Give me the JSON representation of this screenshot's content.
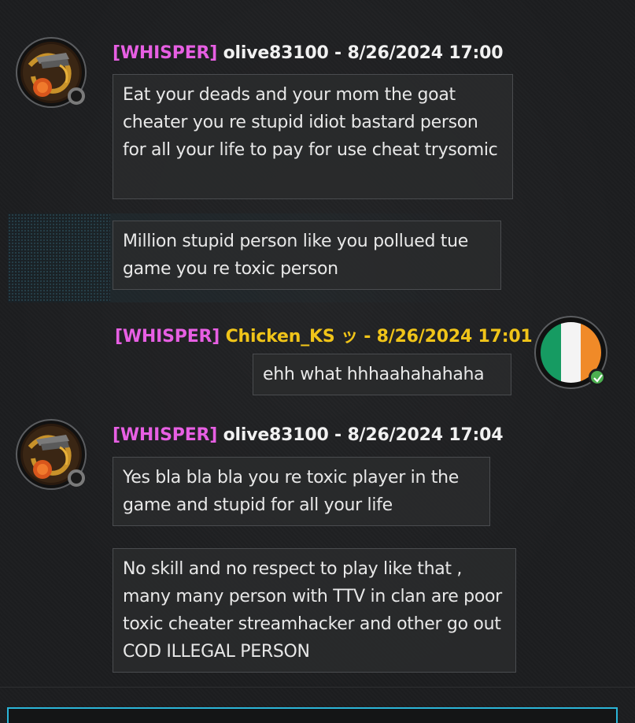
{
  "conversation": {
    "messages": [
      {
        "tag": "[WHISPER]",
        "author": "olive83100",
        "separator": " - ",
        "timestamp": "8/26/2024 17:00",
        "text": "Eat your deads and your mom the goat cheater you  re stupid idiot bastard person for all your life  to pay for use cheat trysomic"
      },
      {
        "text": "Million stupid person like you pollued tue game you re toxic person"
      },
      {
        "tag": "[WHISPER]",
        "author": "Chicken_KS ッ",
        "separator": " - ",
        "timestamp": "8/26/2024 17:01",
        "text": "ehh what hhhaahahahaha"
      },
      {
        "tag": "[WHISPER]",
        "author": "olive83100",
        "separator": " - ",
        "timestamp": "8/26/2024 17:04",
        "text": "Yes  bla bla bla you re toxic player in the game and stupid for all your life"
      },
      {
        "text": "No skill and no respect to play like that , many many person with TTV  in clan are poor toxic cheater streamhacker and other go out COD ILLEGAL PERSON"
      }
    ]
  },
  "colors": {
    "tag": "#e75fe3",
    "own_name": "#f0c419",
    "other_name": "#f1f1f1",
    "input_border": "#2bb5d8",
    "online": "#4caf50"
  },
  "icons": {
    "other_avatar": "dragon-emblem-avatar",
    "own_avatar": "irish-flag-avatar",
    "offline_status": "offline-status-icon",
    "online_status": "online-check-icon"
  }
}
